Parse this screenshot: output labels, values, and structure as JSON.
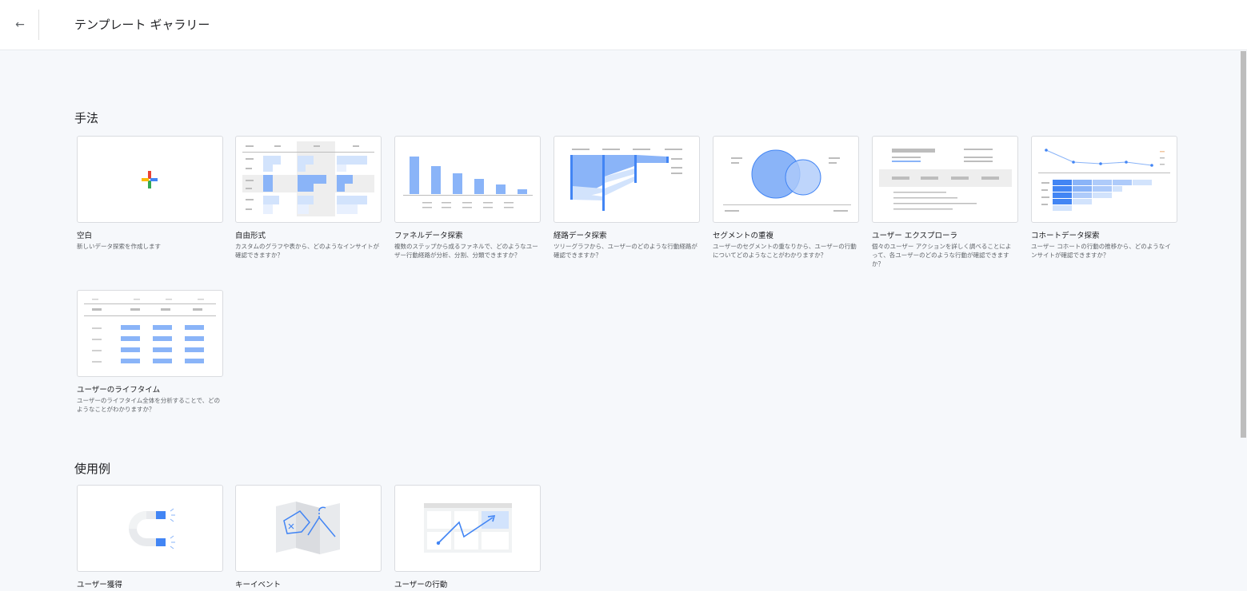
{
  "header": {
    "back_icon": "←",
    "title": "テンプレート ギャラリー"
  },
  "sections": {
    "techniques": {
      "heading": "手法",
      "cards": [
        {
          "title": "空白",
          "desc": "新しいデータ探索を作成します",
          "icon": "plus-icon"
        },
        {
          "title": "自由形式",
          "desc": "カスタムのグラフや表から、どのようなインサイトが確認できますか？",
          "icon": "table-thumbnail"
        },
        {
          "title": "ファネルデータ探索",
          "desc": "複数のステップから成るファネルで、どのようなユーザー行動経路が分析、分割、分類できますか？",
          "icon": "funnel-thumbnail"
        },
        {
          "title": "経路データ探索",
          "desc": "ツリーグラフから、ユーザーのどのような行動経路が確認できますか？",
          "icon": "path-thumbnail"
        },
        {
          "title": "セグメントの重複",
          "desc": "ユーザーのセグメントの重なりから、ユーザーの行動についてどのようなことがわかりますか？",
          "icon": "venn-thumbnail"
        },
        {
          "title": "ユーザー エクスプローラ",
          "desc": "個々のユーザー アクションを詳しく調べることによって、各ユーザーのどのような行動が確認できますか？",
          "icon": "explorer-thumbnail"
        },
        {
          "title": "コホートデータ探索",
          "desc": "ユーザー コホートの行動の推移から、どのようなインサイトが確認できますか？",
          "icon": "cohort-thumbnail"
        },
        {
          "title": "ユーザーのライフタイム",
          "desc": "ユーザーのライフタイム全体を分析することで、どのようなことがわかりますか？",
          "icon": "lifetime-thumbnail"
        }
      ]
    },
    "use_cases": {
      "heading": "使用例",
      "cards": [
        {
          "title": "ユーザー獲得",
          "icon": "magnet-icon"
        },
        {
          "title": "キーイベント",
          "icon": "map-icon"
        },
        {
          "title": "ユーザーの行動",
          "icon": "trend-icon"
        }
      ]
    }
  },
  "colors": {
    "accent_blue": "#8ab4f8",
    "dark_blue": "#4285f4",
    "light_blue": "#d2e3fc",
    "gray": "#dadce0"
  }
}
